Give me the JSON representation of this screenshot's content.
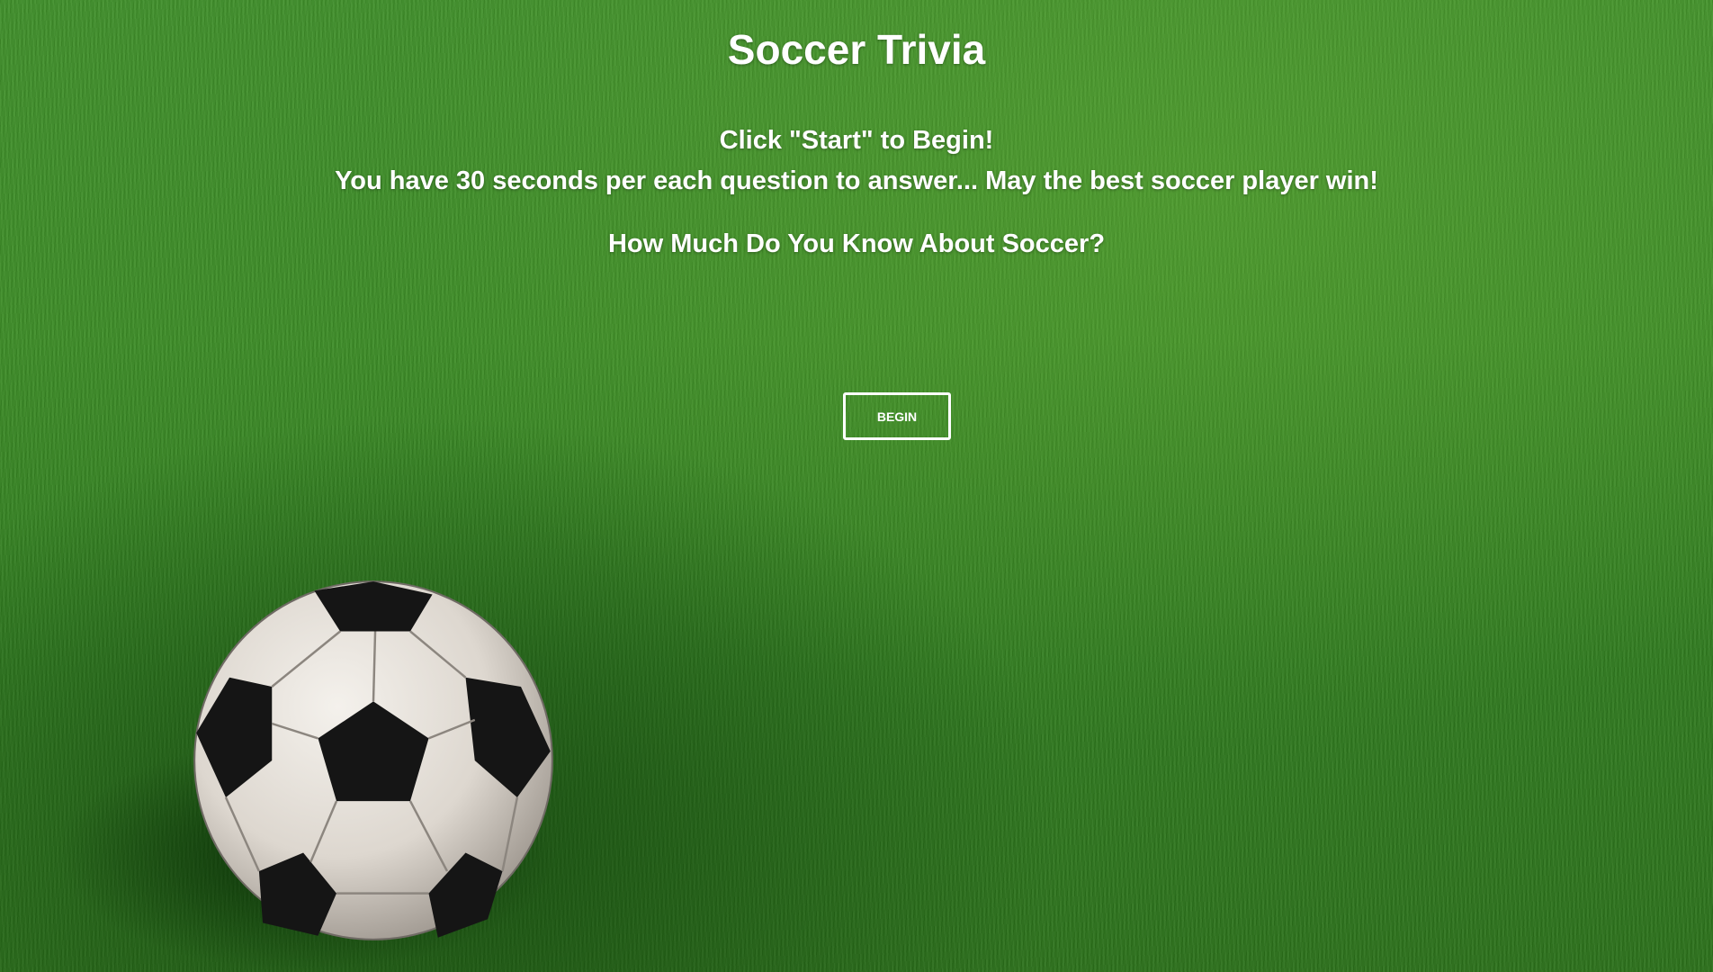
{
  "page": {
    "title": "Soccer Trivia",
    "instruction_start": "Click \"Start\" to Begin!",
    "instruction_timer": "You have 30 seconds per each question to answer... May the best soccer player win!",
    "subtitle": "How Much Do You Know About Soccer?",
    "begin_button_label": "BEGIN"
  },
  "background": {
    "grass_color": "#3c8c26",
    "text_color": "#ffffff"
  },
  "decoration": {
    "ball_icon": "soccer-ball-icon"
  }
}
